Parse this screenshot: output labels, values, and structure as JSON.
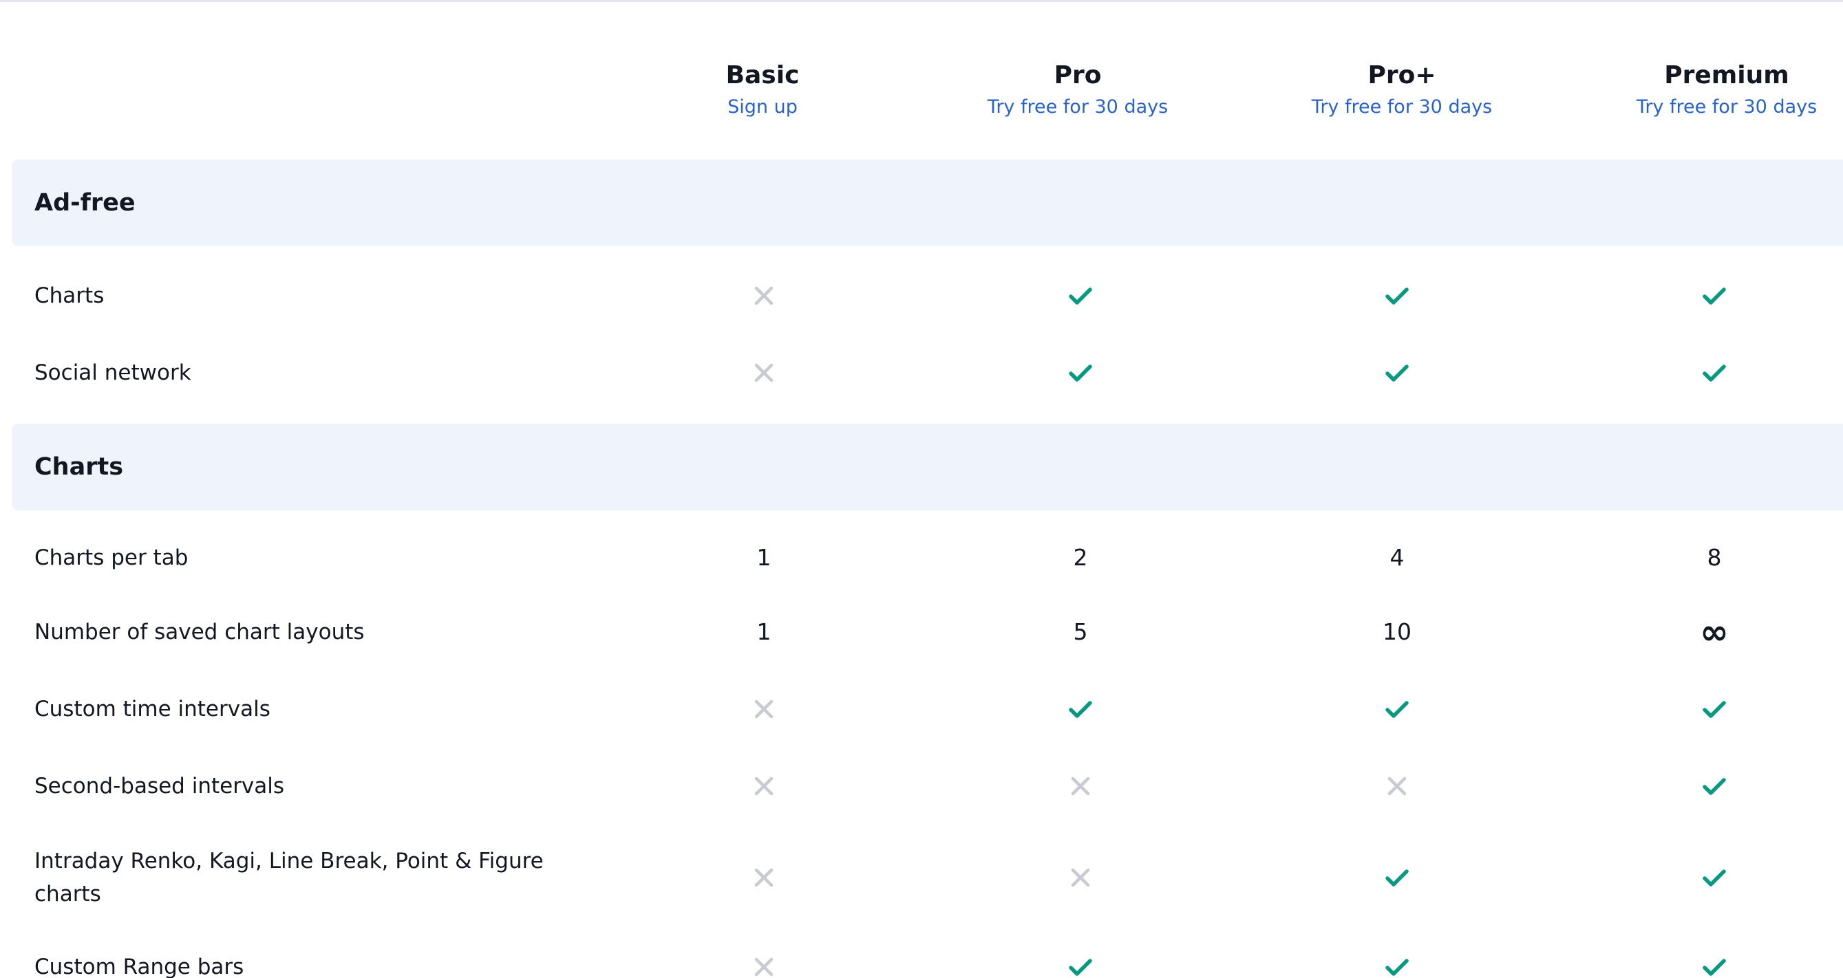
{
  "plans": [
    {
      "name": "Basic",
      "cta": "Sign up"
    },
    {
      "name": "Pro",
      "cta": "Try free for 30 days"
    },
    {
      "name": "Pro+",
      "cta": "Try free for 30 days"
    },
    {
      "name": "Premium",
      "cta": "Try free for 30 days"
    }
  ],
  "sections": [
    {
      "title": "Ad-free",
      "rows": [
        {
          "label": "Charts",
          "values": [
            "cross",
            "check",
            "check",
            "check"
          ]
        },
        {
          "label": "Social network",
          "values": [
            "cross",
            "check",
            "check",
            "check"
          ]
        }
      ]
    },
    {
      "title": "Charts",
      "rows": [
        {
          "label": "Charts per tab",
          "values": [
            "1",
            "2",
            "4",
            "8"
          ]
        },
        {
          "label": "Number of saved chart layouts",
          "values": [
            "1",
            "5",
            "10",
            "∞"
          ]
        },
        {
          "label": "Custom time intervals",
          "values": [
            "cross",
            "check",
            "check",
            "check"
          ]
        },
        {
          "label": "Second-based intervals",
          "values": [
            "cross",
            "cross",
            "cross",
            "check"
          ]
        },
        {
          "label": "Intraday Renko, Kagi, Line Break, Point & Figure charts",
          "values": [
            "cross",
            "cross",
            "check",
            "check"
          ]
        },
        {
          "label": "Custom Range bars",
          "values": [
            "cross",
            "check",
            "check",
            "check"
          ]
        }
      ]
    }
  ],
  "icons": {
    "check": "check-icon",
    "cross": "cross-icon"
  },
  "colors": {
    "check": "#089981",
    "cross": "#c8cbd2",
    "cta": "#2962c8",
    "section_band": "#eff3fc"
  }
}
